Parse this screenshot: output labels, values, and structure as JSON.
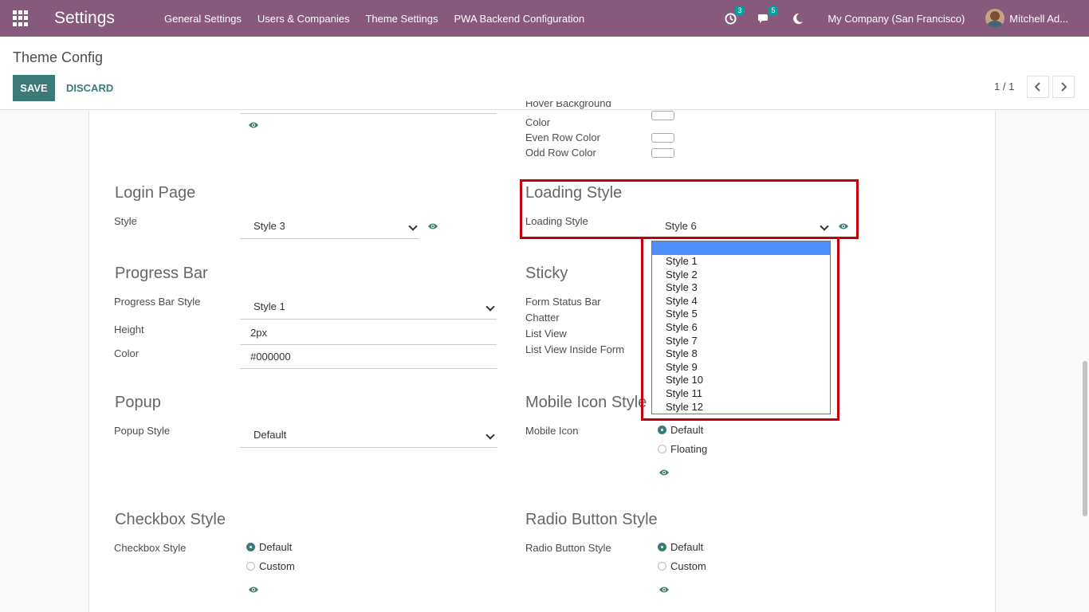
{
  "navbar": {
    "title": "Settings",
    "menu": [
      "General Settings",
      "Users & Companies",
      "Theme Settings",
      "PWA Backend Configuration"
    ],
    "activity_count": "3",
    "message_count": "5",
    "company": "My Company (San Francisco)",
    "user": "Mitchell Ad..."
  },
  "control": {
    "breadcrumb": "Theme Config",
    "save_label": "SAVE",
    "discard_label": "DISCARD",
    "pager": "1 / 1"
  },
  "form": {
    "table_colors": {
      "hover_bg_label_cut": "Hover Background",
      "hover_bg_label_2": "Color",
      "even_row_label": "Even Row Color",
      "odd_row_label": "Odd Row Color"
    },
    "login_page": {
      "title": "Login Page",
      "style_label": "Style",
      "style_value": "Style 3"
    },
    "loading_style": {
      "title": "Loading Style",
      "label": "Loading Style",
      "value": "Style 6"
    },
    "progress_bar": {
      "title": "Progress Bar",
      "style_label": "Progress Bar Style",
      "style_value": "Style 1",
      "height_label": "Height",
      "height_value": "2px",
      "color_label": "Color",
      "color_value": "#000000"
    },
    "sticky": {
      "title": "Sticky",
      "items": [
        "Form Status Bar",
        "Chatter",
        "List View",
        "List View Inside Form"
      ]
    },
    "popup": {
      "title": "Popup",
      "label": "Popup Style",
      "value": "Default"
    },
    "mobile_icon": {
      "title": "Mobile Icon Style",
      "label": "Mobile Icon",
      "options": [
        "Default",
        "Floating"
      ],
      "selected": "Default"
    },
    "checkbox": {
      "title": "Checkbox Style",
      "label": "Checkbox Style",
      "options": [
        "Default",
        "Custom"
      ],
      "selected": "Default"
    },
    "radio_button": {
      "title": "Radio Button Style",
      "label": "Radio Button Style",
      "options": [
        "Default",
        "Custom"
      ],
      "selected": "Default"
    }
  },
  "dropdown": {
    "options": [
      "Style 1",
      "Style 2",
      "Style 3",
      "Style 4",
      "Style 5",
      "Style 6",
      "Style 7",
      "Style 8",
      "Style 9",
      "Style 10",
      "Style 11",
      "Style 12"
    ]
  },
  "colors": {
    "navbar": "#875a7b",
    "primary": "#3b7a76",
    "highlight": "#c0000c",
    "dropdown_selected": "#4f8ffb",
    "badge": "#00a09d"
  }
}
